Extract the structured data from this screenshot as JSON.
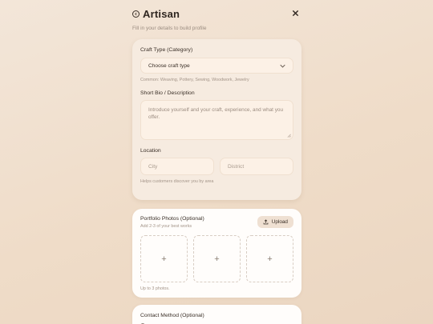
{
  "header": {
    "title": "Artisan",
    "subtitle": "Fill in your details to build profile"
  },
  "form": {
    "craft_type": {
      "label": "Craft Type (Category)",
      "selected": "Choose craft type",
      "hint": "Common: Weaving, Pottery, Sewing, Woodwork, Jewelry"
    },
    "bio": {
      "label": "Short Bio / Description",
      "placeholder": "Introduce yourself and your craft, experience, and what you offer."
    },
    "location": {
      "label": "Location",
      "city_placeholder": "City",
      "district_placeholder": "District",
      "hint": "Helps customers discover you by area"
    }
  },
  "portfolio": {
    "title": "Portfolio Photos (Optional)",
    "subtitle": "Add 2-3 of your best works",
    "upload_label": "Upload",
    "slot_glyph": "+",
    "note": "Up to 3 photos."
  },
  "contact": {
    "title": "Contact Method (Optional)"
  },
  "icons": {
    "back": "back-circle-icon",
    "close": "close-icon",
    "dropdown": "chevron-down-icon",
    "upload": "upload-icon"
  }
}
